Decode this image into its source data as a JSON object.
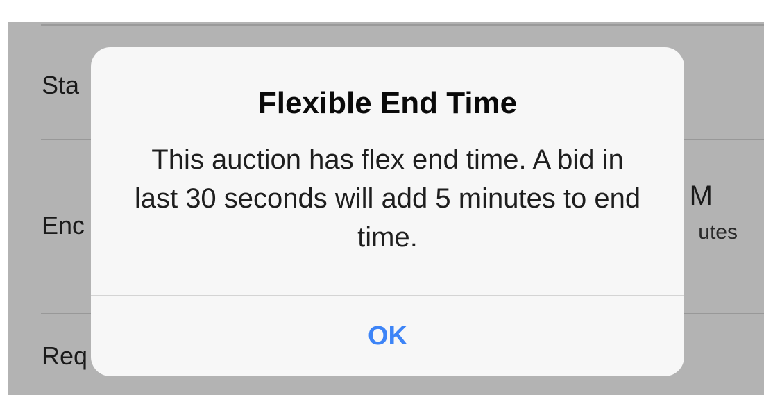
{
  "background": {
    "rows": [
      {
        "label": "Sta"
      },
      {
        "label": "Enc",
        "value": "M",
        "sub": "utes"
      },
      {
        "label": "Req"
      }
    ]
  },
  "dialog": {
    "title": "Flexible End Time",
    "message": "This auction has flex end time. A bid in last 30 seconds will add 5 minutes to end time.",
    "ok_label": "OK"
  },
  "colors": {
    "overlay": "#b3b3b3",
    "dialog_bg": "#f7f7f7",
    "accent": "#3d84f7"
  }
}
